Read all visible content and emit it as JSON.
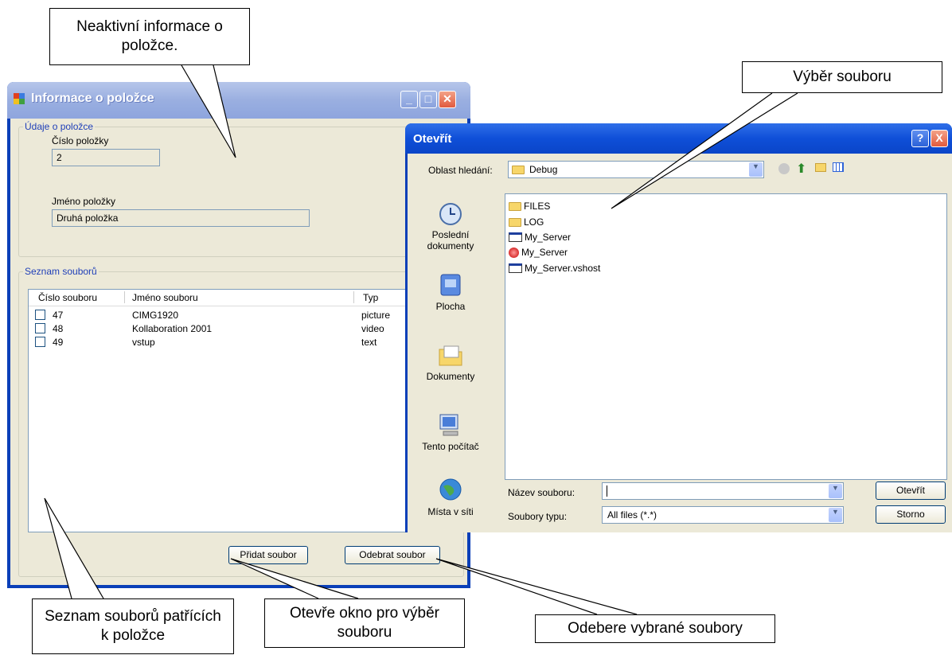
{
  "callouts": {
    "inactive_info": "Neaktivní informace o položce.",
    "file_select": "Výběr souboru",
    "file_list": "Seznam souborů patřících k položce",
    "open_window": "Otevře okno pro výběr souboru",
    "remove_files": "Odebere vybrané soubory"
  },
  "item_window": {
    "title": "Informace o položce",
    "details_group": "Údaje o položce",
    "number_label": "Číslo položky",
    "number_value": "2",
    "name_label": "Jméno položky",
    "name_value": "Druhá položka",
    "files_group": "Seznam souborů",
    "columns": [
      "Číslo souboru",
      "Jméno souboru",
      "Typ"
    ],
    "rows": [
      {
        "num": "47",
        "name": "CIMG1920",
        "type": "picture"
      },
      {
        "num": "48",
        "name": "Kollaboration 2001",
        "type": "video"
      },
      {
        "num": "49",
        "name": "vstup",
        "type": "text"
      }
    ],
    "add_button": "Přidat soubor",
    "remove_button": "Odebrat soubor"
  },
  "open_dialog": {
    "title": "Otevřít",
    "look_in_label": "Oblast hledání:",
    "look_in_value": "Debug",
    "places": [
      "Poslední dokumenty",
      "Plocha",
      "Dokumenty",
      "Tento počítač",
      "Místa v síti"
    ],
    "files": [
      "FILES",
      "LOG",
      "My_Server",
      "My_Server",
      "My_Server.vshost"
    ],
    "file_name_label": "Název souboru:",
    "file_name_value": "",
    "file_type_label": "Soubory typu:",
    "file_type_value": "All files (*.*)",
    "open_button": "Otevřít",
    "cancel_button": "Storno",
    "help_button": "?",
    "close_button": "X"
  }
}
